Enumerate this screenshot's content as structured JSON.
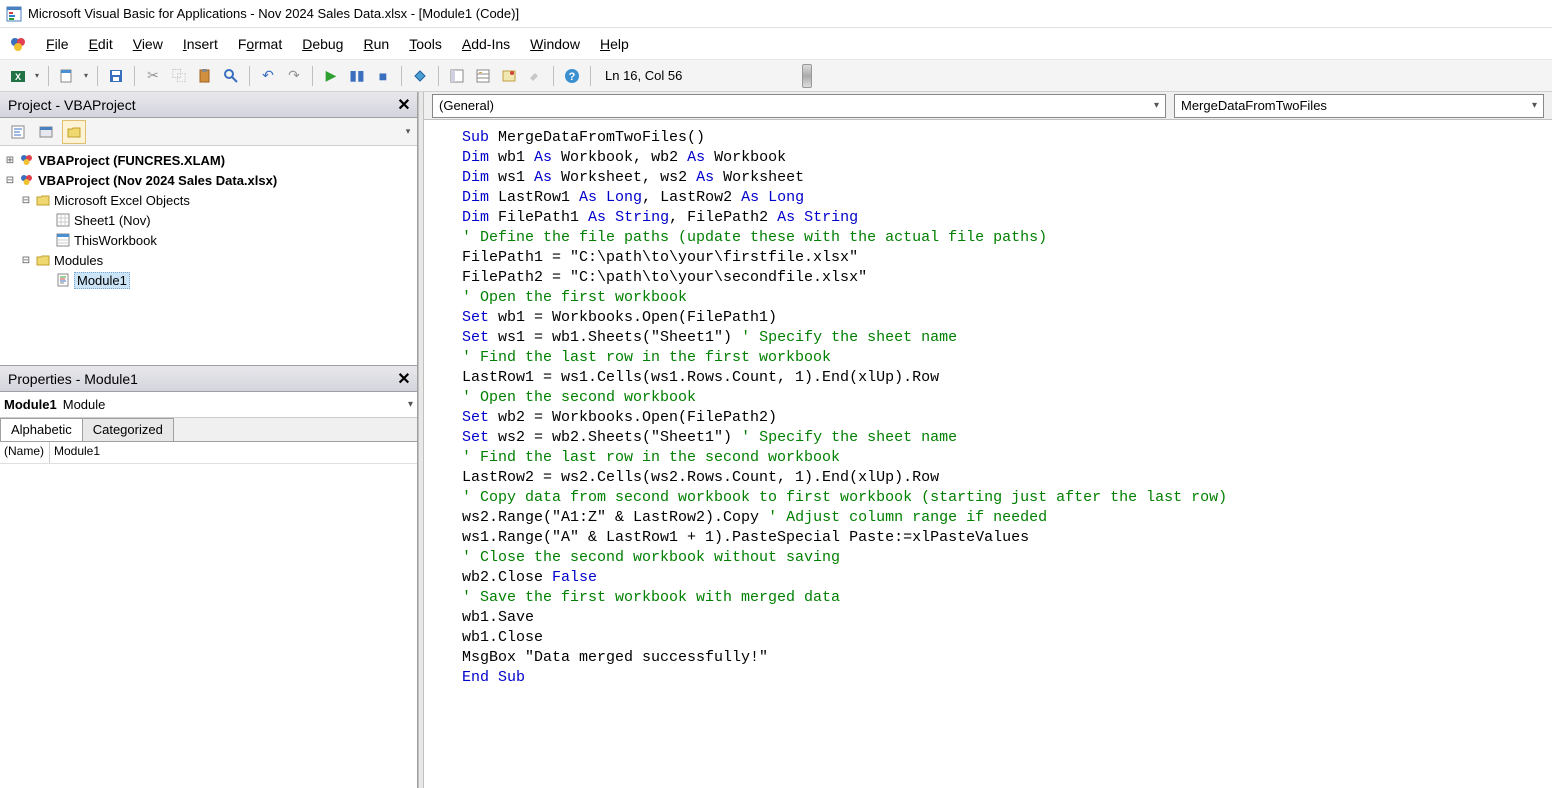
{
  "titlebar": {
    "title": "Microsoft Visual Basic for Applications - Nov 2024 Sales Data.xlsx - [Module1 (Code)]"
  },
  "menus": {
    "file": "File",
    "edit": "Edit",
    "view": "View",
    "insert": "Insert",
    "format": "Format",
    "debug": "Debug",
    "run": "Run",
    "tools": "Tools",
    "addins": "Add-Ins",
    "window": "Window",
    "help": "Help"
  },
  "toolbar": {
    "cursor_pos": "Ln 16, Col 56"
  },
  "project_panel": {
    "title": "Project - VBAProject",
    "tree": {
      "p1": "VBAProject (FUNCRES.XLAM)",
      "p2": "VBAProject (Nov 2024 Sales Data.xlsx)",
      "p2_folder1": "Microsoft Excel Objects",
      "p2_sheet1": "Sheet1 (Nov)",
      "p2_thiswb": "ThisWorkbook",
      "p2_folder2": "Modules",
      "p2_mod1": "Module1"
    }
  },
  "properties_panel": {
    "title": "Properties - Module1",
    "obj_name": "Module1",
    "obj_type": "Module",
    "tab_alpha": "Alphabetic",
    "tab_cat": "Categorized",
    "row_name_label": "(Name)",
    "row_name_value": "Module1"
  },
  "code_header": {
    "left_dd": "(General)",
    "right_dd": "MergeDataFromTwoFiles"
  },
  "code": {
    "l1_a": "Sub",
    "l1_b": " MergeDataFromTwoFiles()",
    "l2_a": "Dim",
    "l2_b": " wb1 ",
    "l2_c": "As",
    "l2_d": " Workbook, wb2 ",
    "l2_e": "As",
    "l2_f": " Workbook",
    "l3_a": "Dim",
    "l3_b": " ws1 ",
    "l3_c": "As",
    "l3_d": " Worksheet, ws2 ",
    "l3_e": "As",
    "l3_f": " Worksheet",
    "l4_a": "Dim",
    "l4_b": " LastRow1 ",
    "l4_c": "As",
    "l4_d": " Long",
    "l4_e": ", LastRow2 ",
    "l4_f": "As",
    "l4_g": " Long",
    "l5_a": "Dim",
    "l5_b": " FilePath1 ",
    "l5_c": "As",
    "l5_d": " String",
    "l5_e": ", FilePath2 ",
    "l5_f": "As",
    "l5_g": " String",
    "l6": "' Define the file paths (update these with the actual file paths)",
    "l7": "FilePath1 = \"C:\\path\\to\\your\\firstfile.xlsx\"",
    "l8": "FilePath2 = \"C:\\path\\to\\your\\secondfile.xlsx\"",
    "l9": "' Open the first workbook",
    "l10_a": "Set",
    "l10_b": " wb1 = Workbooks.Open(FilePath1)",
    "l11_a": "Set",
    "l11_b": " ws1 = wb1.Sheets(\"Sheet1\") ",
    "l11_c": "' Specify the sheet name",
    "l12": "' Find the last row in the first workbook",
    "l13": "LastRow1 = ws1.Cells(ws1.Rows.Count, 1).End(xlUp).Row",
    "l14": "' Open the second workbook",
    "l15_a": "Set",
    "l15_b": " wb2 = Workbooks.Open(FilePath2)",
    "l16_a": "Set",
    "l16_b": " ws2 = wb2.Sheets(\"Sheet1\") ",
    "l16_c": "' Specify the sheet name",
    "l17": "' Find the last row in the second workbook",
    "l18": "LastRow2 = ws2.Cells(ws2.Rows.Count, 1).End(xlUp).Row",
    "l19": "' Copy data from second workbook to first workbook (starting just after the last row)",
    "l20_a": "ws2.Range(\"A1:Z\" & LastRow2).Copy ",
    "l20_b": "' Adjust column range if needed",
    "l21": "ws1.Range(\"A\" & LastRow1 + 1).PasteSpecial Paste:=xlPasteValues",
    "l22": "' Close the second workbook without saving",
    "l23_a": "wb2.Close ",
    "l23_b": "False",
    "l24": "' Save the first workbook with merged data",
    "l25": "wb1.Save",
    "l26": "wb1.Close",
    "l27": "MsgBox \"Data merged successfully!\"",
    "l28": "End Sub"
  }
}
